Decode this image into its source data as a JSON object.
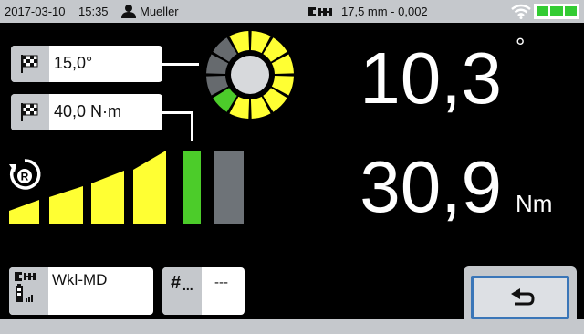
{
  "status": {
    "date": "2017-03-10",
    "time": "15:35",
    "user": "Mueller",
    "tool_info": "17,5 mm - 0,002",
    "battery_color": "#33cc33"
  },
  "targets": {
    "angle": "15,0°",
    "torque": "40,0 N·m"
  },
  "readout": {
    "angle_value": "10,3",
    "angle_unit": "°",
    "torque_value": "30,9",
    "torque_unit": "Nm"
  },
  "ring": {
    "segment_colors": [
      "#ffff33",
      "#ffff33",
      "#ffff33",
      "#ffff33",
      "#ffff33",
      "#ffff33",
      "#ffff33",
      "#4ccc2a",
      "#666a6e",
      "#666a6e",
      "#666a6e",
      "#ffff33"
    ]
  },
  "bars": {
    "levels": [
      "yellow",
      "yellow",
      "yellow",
      "yellow",
      "yellow",
      "green",
      "gray"
    ],
    "colors": {
      "yellow": "#ffff33",
      "green": "#4ccc2a",
      "gray": "#6e7378"
    }
  },
  "footer": {
    "tool_name": "Wkl-MD",
    "count_symbol": "#",
    "count_dots": "...",
    "count_value": "---"
  },
  "icons": {
    "user": "user-icon",
    "tool": "wrench-icon",
    "wifi": "wifi-icon",
    "flag": "checkered-flag-icon",
    "rotation": "rotation-right-icon",
    "back": "back-arrow-icon"
  }
}
